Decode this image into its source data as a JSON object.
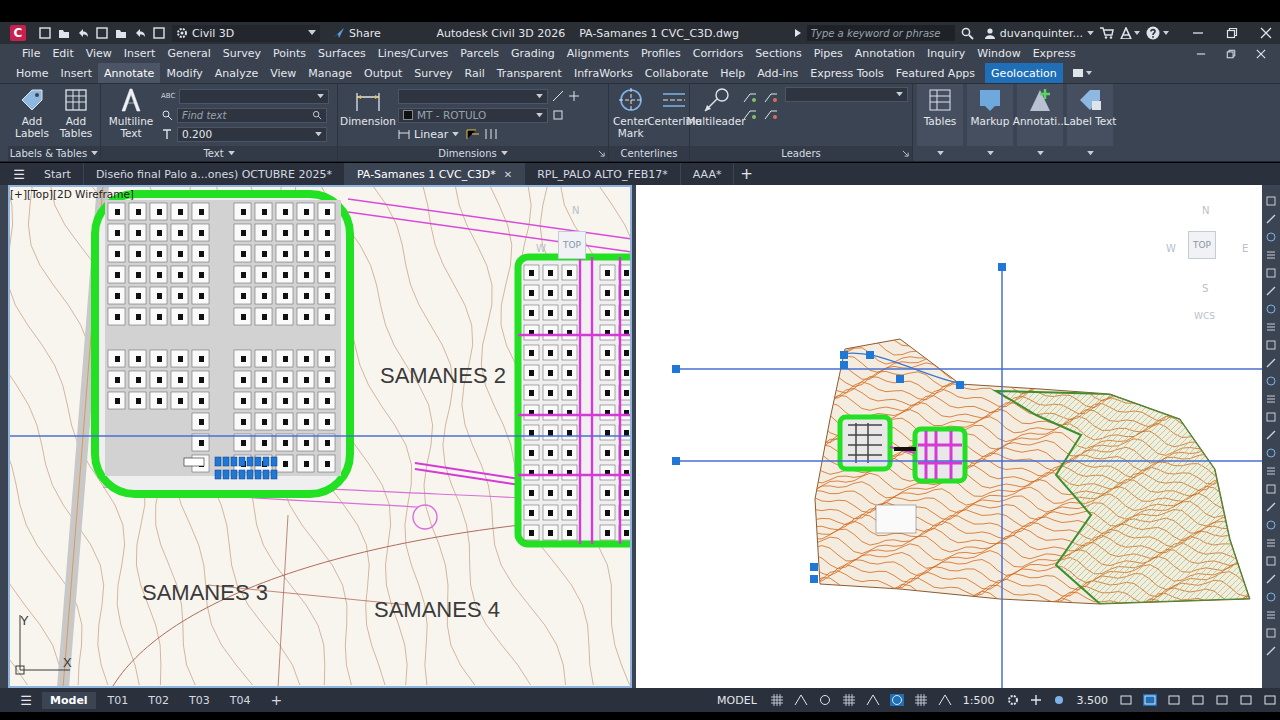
{
  "titleBar": {
    "appLetter": "C",
    "workspace": "Civil 3D",
    "share": "Share",
    "appName": "Autodesk Civil 3D 2026",
    "fileName": "PA-Samanes 1 CVC_C3D.dwg",
    "searchPlaceholder": "Type a keyword or phrase",
    "user": "duvanquinter..."
  },
  "menu": [
    "File",
    "Edit",
    "View",
    "Insert",
    "General",
    "Survey",
    "Points",
    "Surfaces",
    "Lines/Curves",
    "Parcels",
    "Grading",
    "Alignments",
    "Profiles",
    "Corridors",
    "Sections",
    "Pipes",
    "Annotation",
    "Inquiry",
    "Window",
    "Express"
  ],
  "ribbonTabs": [
    {
      "label": "Home",
      "selected": false,
      "contextual": false
    },
    {
      "label": "Insert",
      "selected": false,
      "contextual": false
    },
    {
      "label": "Annotate",
      "selected": true,
      "contextual": false
    },
    {
      "label": "Modify",
      "selected": false,
      "contextual": false
    },
    {
      "label": "Analyze",
      "selected": false,
      "contextual": false
    },
    {
      "label": "View",
      "selected": false,
      "contextual": false
    },
    {
      "label": "Manage",
      "selected": false,
      "contextual": false
    },
    {
      "label": "Output",
      "selected": false,
      "contextual": false
    },
    {
      "label": "Survey",
      "selected": false,
      "contextual": false
    },
    {
      "label": "Rail",
      "selected": false,
      "contextual": false
    },
    {
      "label": "Transparent",
      "selected": false,
      "contextual": false
    },
    {
      "label": "InfraWorks",
      "selected": false,
      "contextual": false
    },
    {
      "label": "Collaborate",
      "selected": false,
      "contextual": false
    },
    {
      "label": "Help",
      "selected": false,
      "contextual": false
    },
    {
      "label": "Add-ins",
      "selected": false,
      "contextual": false
    },
    {
      "label": "Express Tools",
      "selected": false,
      "contextual": false
    },
    {
      "label": "Featured Apps",
      "selected": false,
      "contextual": false
    },
    {
      "label": "Geolocation",
      "selected": false,
      "contextual": true
    }
  ],
  "ribbon": {
    "labelsTables": {
      "title": "Labels & Tables",
      "tools": [
        "Add Labels",
        "Add Tables"
      ]
    },
    "text": {
      "title": "Text",
      "tool": "Multiline Text",
      "spell": "ABC",
      "findPlaceholder": "Find text",
      "height": "0.200"
    },
    "dimensions": {
      "title": "Dimensions",
      "tool": "Dimension",
      "textStyle": "MT - ROTULO",
      "linear": "Linear"
    },
    "centerlines": {
      "title": "Centerlines",
      "tools": [
        "Center Mark",
        "Centerline"
      ]
    },
    "leaders": {
      "title": "Leaders",
      "tool": "Multileader"
    },
    "extra": [
      "Tables",
      "Markup",
      "Annotati...",
      "Label Text"
    ]
  },
  "fileTabs": {
    "menu": "☰",
    "tabs": [
      {
        "label": "Start",
        "selected": false
      },
      {
        "label": "Diseño final Palo a...ones) OCTUBRE 2025*",
        "selected": false
      },
      {
        "label": "PA-Samanes 1 CVC_C3D*",
        "selected": true
      },
      {
        "label": "RPL_PALO ALTO_FEB17*",
        "selected": false
      },
      {
        "label": "AAA*",
        "selected": false
      }
    ],
    "close": "✕",
    "add": "+"
  },
  "viewports": {
    "left": {
      "label": "[+][Top][2D Wireframe]",
      "active": true,
      "cube": {
        "face": "TOP",
        "n": "N",
        "w": "W"
      },
      "mapLabels": [
        "SAMANES 2",
        "SAMANES 3",
        "SAMANES 4"
      ],
      "ucs": {
        "y": "Y",
        "x": "X"
      }
    },
    "right": {
      "active": false,
      "cube": {
        "face": "TOP",
        "n": "N",
        "w": "W",
        "e": "E",
        "s": "S",
        "ucs": "WCS"
      }
    }
  },
  "layoutTabs": {
    "menu": "☰",
    "tabs": [
      {
        "label": "Model",
        "selected": true
      },
      {
        "label": "T01",
        "selected": false
      },
      {
        "label": "T02",
        "selected": false
      },
      {
        "label": "T03",
        "selected": false
      },
      {
        "label": "T04",
        "selected": false
      }
    ],
    "add": "+"
  },
  "statusBar": {
    "mode": "MODEL",
    "scale": "1:500",
    "lineweight": "3.500"
  }
}
